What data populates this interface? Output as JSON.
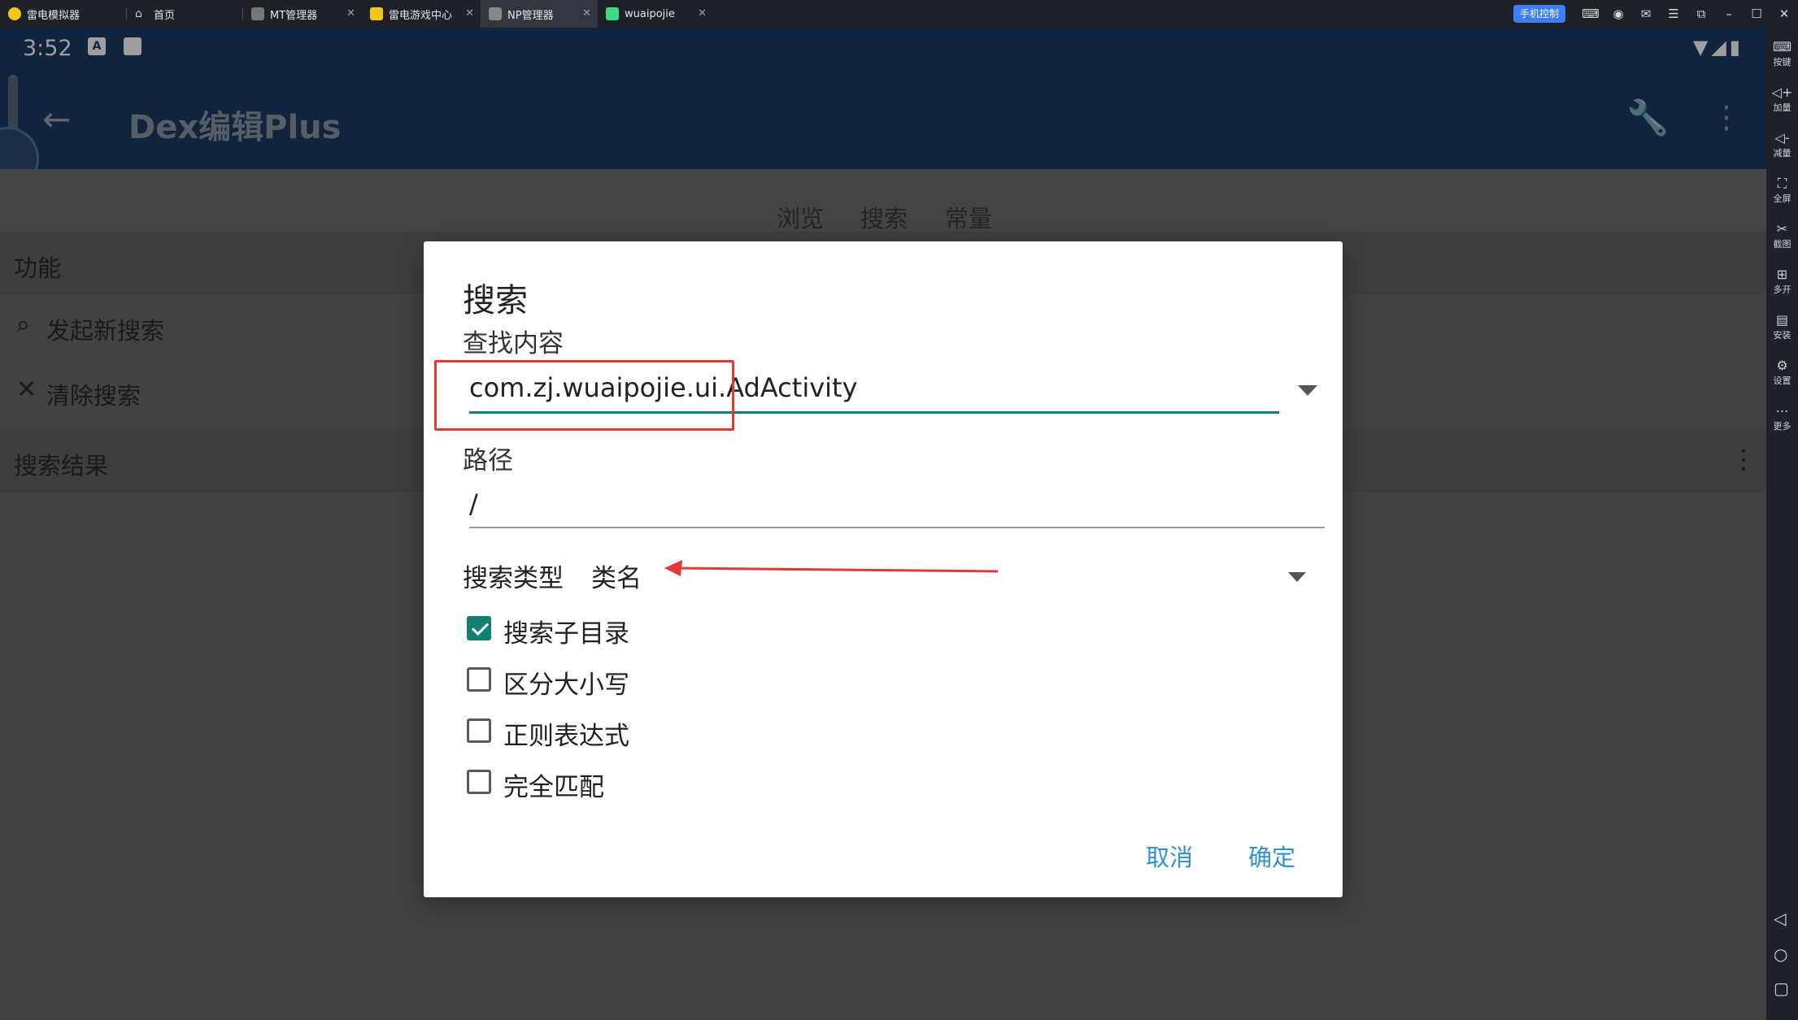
{
  "emulator": {
    "tabs": [
      {
        "label": "雷电模拟器",
        "icon": "ldplayer-logo-icon",
        "color": "#f5c518"
      },
      {
        "label": "首页",
        "icon": "home-icon",
        "color": "#cccccc"
      },
      {
        "label": "MT管理器",
        "icon": "mt-manager-icon",
        "color": "#888888"
      },
      {
        "label": "雷电游戏中心",
        "icon": "game-center-icon",
        "color": "#f5c518"
      },
      {
        "label": "NP管理器",
        "icon": "np-manager-icon",
        "color": "#888888"
      },
      {
        "label": "wuaipojie",
        "icon": "android-app-icon",
        "color": "#3ddc84"
      }
    ],
    "active_tab": "NP管理器",
    "phone_control": "手机控制",
    "sidebar": [
      {
        "label": "按键",
        "icon": "keyboard-icon"
      },
      {
        "label": "加量",
        "icon": "volume-up-icon"
      },
      {
        "label": "减量",
        "icon": "volume-down-icon"
      },
      {
        "label": "全屏",
        "icon": "fullscreen-icon"
      },
      {
        "label": "截图",
        "icon": "scissors-icon"
      },
      {
        "label": "多开",
        "icon": "multi-instance-icon"
      },
      {
        "label": "安装",
        "icon": "apk-install-icon"
      },
      {
        "label": "设置",
        "icon": "settings-icon"
      },
      {
        "label": "更多",
        "icon": "more-icon"
      }
    ]
  },
  "android": {
    "clock": "3:52",
    "app_title": "Dex编辑Plus",
    "tabs": [
      "浏览",
      "搜索",
      "常量"
    ],
    "function_header": "功能",
    "functions": [
      {
        "label": "发起新搜索",
        "icon": "search-icon"
      },
      {
        "label": "清除搜索",
        "icon": "close-icon"
      }
    ],
    "results_header": "搜索结果"
  },
  "dialog": {
    "title": "搜索",
    "find_label": "查找内容",
    "find_value": "com.zj.wuaipojie.ui.AdActivity",
    "path_label": "路径",
    "path_value": "/",
    "type_label": "搜索类型",
    "type_value": "类名",
    "options": [
      {
        "label": "搜索子目录",
        "checked": true
      },
      {
        "label": "区分大小写",
        "checked": false
      },
      {
        "label": "正则表达式",
        "checked": false
      },
      {
        "label": "完全匹配",
        "checked": false
      }
    ],
    "cancel": "取消",
    "confirm": "确定"
  },
  "colors": {
    "accent": "#13806f",
    "button_text": "#2f91d6",
    "annotation_red": "#e53935",
    "appbar": "#1c3a63"
  }
}
